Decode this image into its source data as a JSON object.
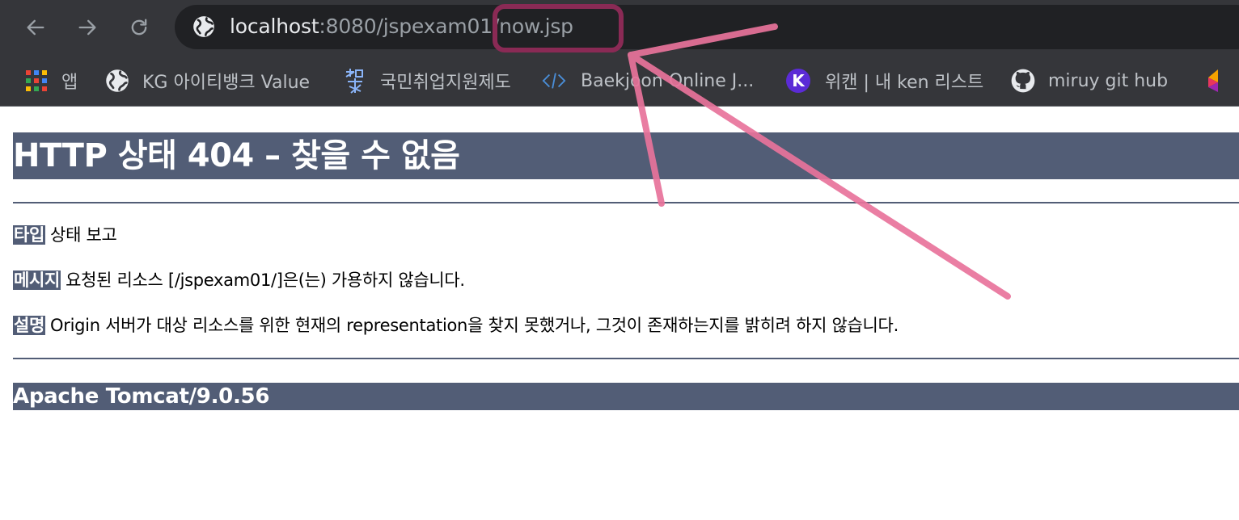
{
  "browser": {
    "url": {
      "host": "localhost",
      "path": ":8080/jspexam01/now.jsp"
    },
    "bookmarks": [
      {
        "label": "앱",
        "icon": "apps-grid-icon"
      },
      {
        "label": "KG 아이티뱅크 Value",
        "icon": "globe-icon"
      },
      {
        "label": "국민취업지원제도",
        "icon": "site-logo-icon"
      },
      {
        "label": "Baekjoon Online J...",
        "icon": "code-brackets-icon"
      },
      {
        "label": "위캔 | 내 ken 리스트",
        "icon": "k-avatar-icon",
        "icon_letter": "K"
      },
      {
        "label": "miruy git hub",
        "icon": "github-icon"
      }
    ]
  },
  "error_page": {
    "title": "HTTP 상태 404 – 찾을 수 없음",
    "type_label": "타입",
    "type_value": "상태 보고",
    "message_label": "메시지",
    "message_value": "요청된 리소스 [/jspexam01/]은(는) 가용하지 않습니다.",
    "description_label": "설명",
    "description_value": "Origin 서버가 대상 리소스를 위한 현재의 representation을 찾지 못했거나, 그것이 존재하는지를 밝히려 하지 않습니다.",
    "server": "Apache Tomcat/9.0.56"
  },
  "colors": {
    "chrome_bg": "#35363a",
    "omnibox_bg": "#202124",
    "tomcat_header": "#525d76",
    "annotation_box": "#8a2a55",
    "annotation_arrow": "#e8739b"
  }
}
